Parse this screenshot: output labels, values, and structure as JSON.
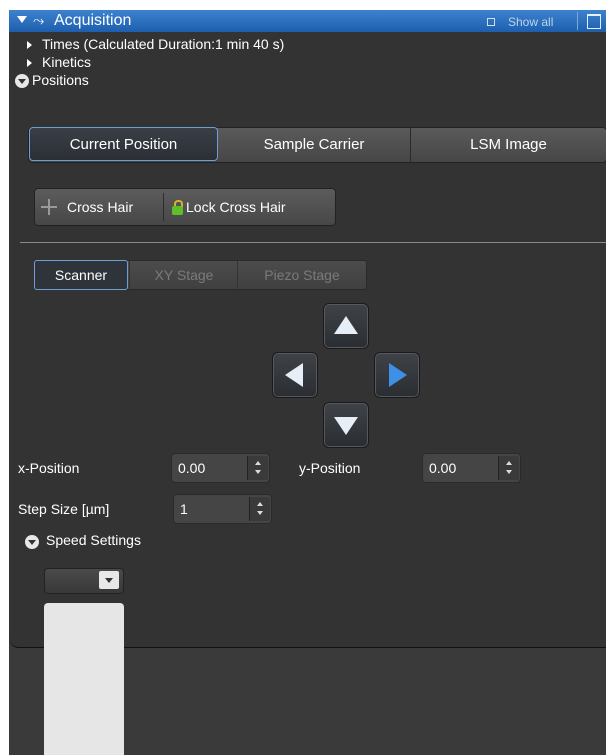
{
  "titlebar": {
    "title": "Acquisition",
    "show_all_label": "Show all",
    "expand_icon": "caret-down-icon",
    "glyph_icon": "acquisition-icon",
    "corner_icon": "window-icon"
  },
  "tree": {
    "times_label": "Times (Calculated Duration:1 min 40 s)",
    "kinetics_label": "Kinetics",
    "positions_label": "Positions"
  },
  "position_tabs": [
    "Current Position",
    "Sample Carrier",
    "LSM Image"
  ],
  "crosshair": {
    "cross_hair_label": "Cross Hair",
    "lock_label": "Lock Cross Hair"
  },
  "stage_tabs": [
    "Scanner",
    "XY Stage",
    "Piezo Stage"
  ],
  "fields": {
    "x_label": "x-Position",
    "x_value": "0.00",
    "y_label": "y-Position",
    "y_value": "0.00",
    "step_label": "Step Size [µm]",
    "step_value": "1"
  },
  "speed_settings_label": "Speed Settings",
  "colors": {
    "title_blue": "#2a6fc0",
    "panel_bg": "#333333",
    "accent_arrow": "#3e8fe6"
  }
}
